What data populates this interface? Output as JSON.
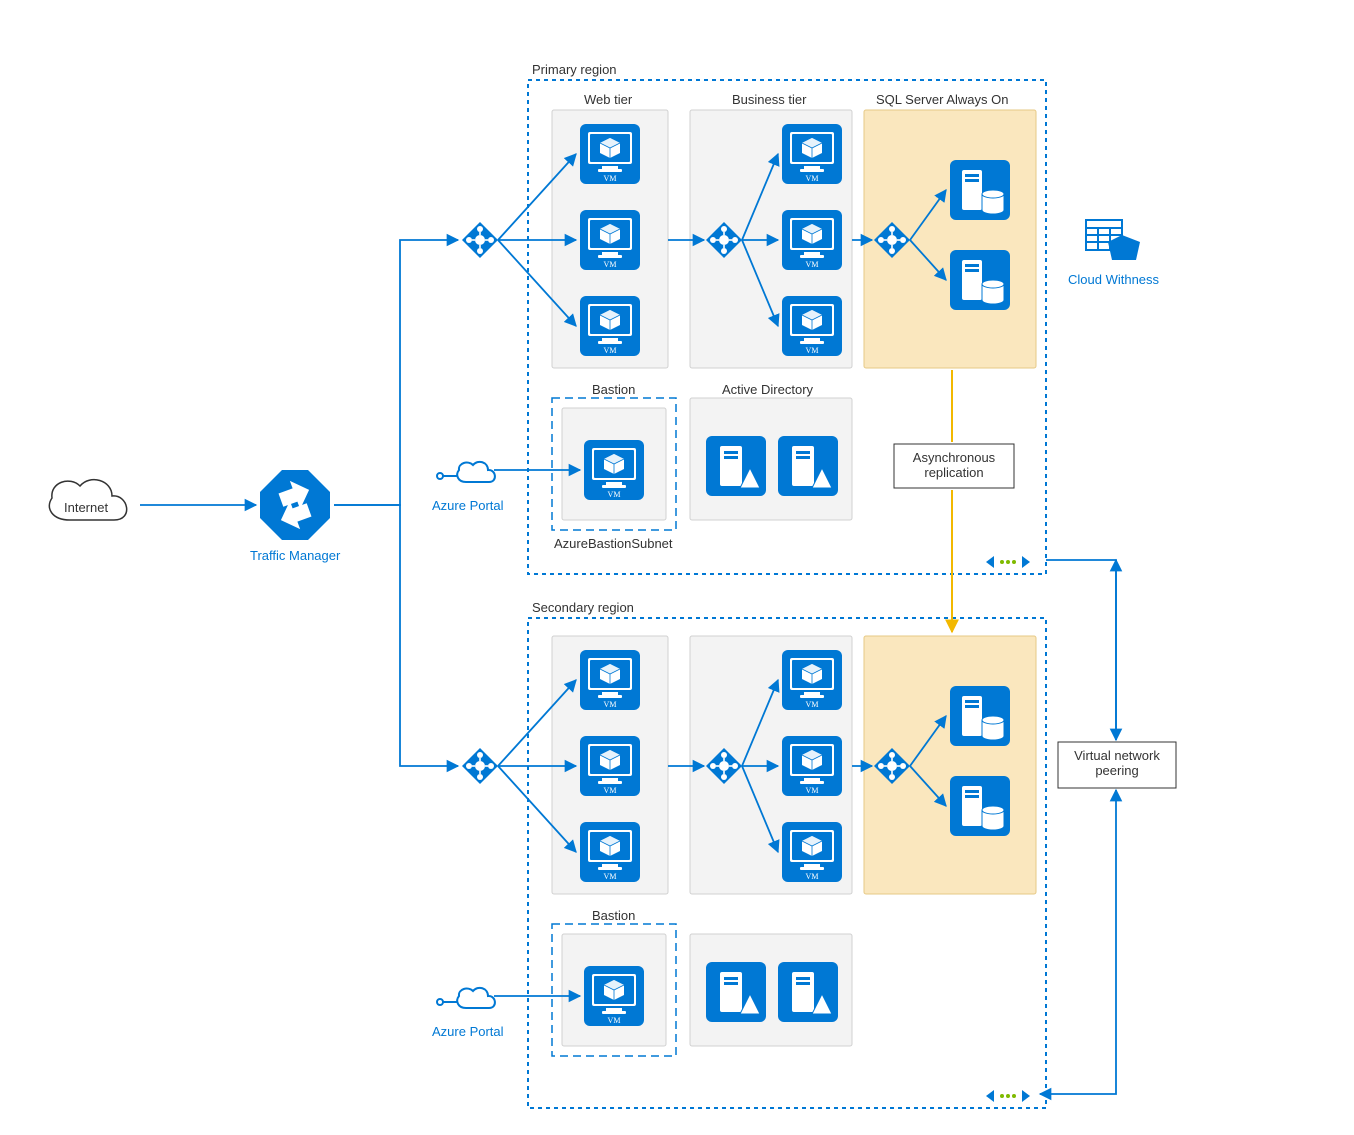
{
  "colors": {
    "azure_blue": "#0078D4",
    "azure_dark": "#005BA1",
    "panel_grey": "#F3F3F3",
    "panel_border": "#D0D0D0",
    "sql_panel": "#FAE7BE",
    "sql_panel_border": "#E6C985",
    "dashed_blue": "#0078D4",
    "arrow_blue": "#0078D4",
    "arrow_orange": "#F2B800"
  },
  "labels": {
    "internet": "Internet",
    "traffic_manager": "Traffic Manager",
    "primary_region": "Primary region",
    "secondary_region": "Secondary region",
    "web_tier": "Web tier",
    "business_tier": "Business tier",
    "sql_always_on": "SQL Server Always On",
    "bastion": "Bastion",
    "active_directory": "Active Directory",
    "azure_bastion_subnet": "AzureBastionSubnet",
    "azure_portal": "Azure Portal",
    "cloud_witness": "Cloud Withness",
    "async_replication_l1": "Asynchronous",
    "async_replication_l2": "replication",
    "vnet_peering_l1": "Virtual network",
    "vnet_peering_l2": "peering",
    "vm": "VM"
  }
}
